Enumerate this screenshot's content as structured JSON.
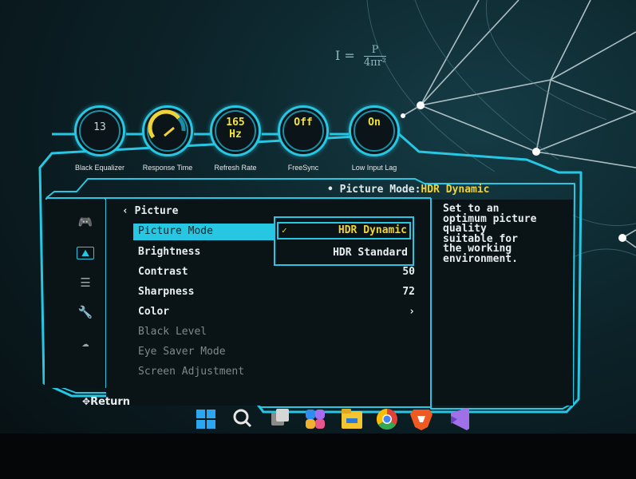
{
  "formula": {
    "prefix": "I =",
    "numerator": "P",
    "denominator": "4πr²"
  },
  "quick_settings": [
    {
      "label": "Black Equalizer",
      "value": "13",
      "style": "white"
    },
    {
      "label": "Response Time",
      "value": "",
      "style": "gauge"
    },
    {
      "label": "Refresh Rate",
      "value": "165",
      "value2": "Hz",
      "style": "yellow"
    },
    {
      "label": "FreeSync",
      "value": "Off",
      "style": "yellow"
    },
    {
      "label": "Low Input Lag",
      "value": "On",
      "style": "yellow"
    }
  ],
  "status": {
    "prefix": "• Picture Mode:",
    "value": "HDR Dynamic"
  },
  "sidebar": {
    "icons": [
      {
        "name": "game-icon",
        "glyph": "🎮",
        "active": false
      },
      {
        "name": "picture-icon",
        "glyph": "⛰",
        "active": true
      },
      {
        "name": "sliders-icon",
        "glyph": "☰",
        "active": false
      },
      {
        "name": "wrench-icon",
        "glyph": "🔧",
        "active": false
      },
      {
        "name": "cloud-icon",
        "glyph": "☁",
        "active": false
      }
    ]
  },
  "breadcrumb": "‹ Picture",
  "menu": [
    {
      "label": "Picture Mode",
      "value": "",
      "state": "selected"
    },
    {
      "label": "Brightness",
      "value": "",
      "state": "normal"
    },
    {
      "label": "Contrast",
      "value": "50",
      "state": "normal"
    },
    {
      "label": "Sharpness",
      "value": "72",
      "state": "normal"
    },
    {
      "label": "Color",
      "value": "›",
      "state": "normal"
    },
    {
      "label": "Black Level",
      "value": "",
      "state": "disabled"
    },
    {
      "label": "Eye Saver Mode",
      "value": "",
      "state": "disabled"
    },
    {
      "label": "Screen Adjustment",
      "value": "",
      "state": "disabled"
    }
  ],
  "dropdown": {
    "options": [
      {
        "label": "HDR Dynamic",
        "selected": true,
        "check": "✓"
      },
      {
        "label": "HDR Standard",
        "selected": false
      }
    ]
  },
  "info_text": "Set to an\noptimum picture\nquality\nsuitable for\nthe working\nenvironment.",
  "footer": {
    "return_icon": "✥",
    "return_label": "Return"
  },
  "taskbar": [
    {
      "name": "windows-start-icon",
      "color": "#2aa7f0"
    },
    {
      "name": "search-icon",
      "color": "#e6e6e6"
    },
    {
      "name": "task-view-icon",
      "color": "#cfcfcf"
    },
    {
      "name": "copilot-icon",
      "color": "#7f6cf0"
    },
    {
      "name": "file-explorer-icon",
      "color": "#f3c530"
    },
    {
      "name": "chrome-icon",
      "color": "#e44134"
    },
    {
      "name": "brave-icon",
      "color": "#f05a22"
    },
    {
      "name": "visual-studio-icon",
      "color": "#a070e8"
    }
  ],
  "colors": {
    "accent": "#27c7e3",
    "highlight": "#f0d23a",
    "background": "#081317"
  }
}
